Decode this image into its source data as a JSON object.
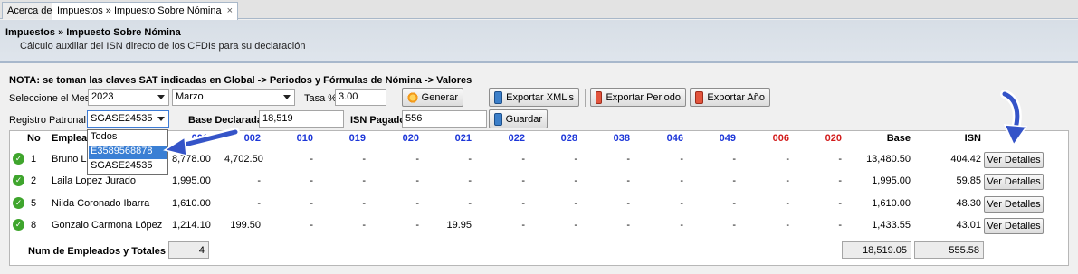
{
  "tabs": [
    {
      "label": "Acerca de"
    },
    {
      "label": "Impuestos » Impuesto Sobre Nómina",
      "close": "×"
    }
  ],
  "header": {
    "title": "Impuestos » Impuesto Sobre Nómina",
    "subtitle": "Cálculo auxiliar del ISN directo de los CFDIs para su declaración"
  },
  "note": "NOTA: se toman las claves SAT indicadas en Global -> Periodos y Fórmulas de Nómina -> Valores",
  "form": {
    "mes_label": "Seleccione el Mes",
    "year_value": "2023",
    "month_value": "Marzo",
    "tasa_label": "Tasa %",
    "tasa_value": "3.00",
    "generar_label": "Generar",
    "exportar_xml_label": "Exportar XML's",
    "exportar_periodo_label": "Exportar Periodo",
    "exportar_anio_label": "Exportar Año",
    "registro_label": "Registro Patronal",
    "registro_value": "SGASE24535",
    "base_label": "Base Declarada",
    "base_value": "18,519",
    "isn_label": "ISN Pagado",
    "isn_value": "556",
    "guardar_label": "Guardar"
  },
  "dropdown": {
    "options": [
      "Todos",
      "E3589568878",
      "SGASE24535"
    ],
    "highlighted": "E3589568878"
  },
  "table": {
    "headers": {
      "no": "No",
      "empleado": "Emplead",
      "c001": "001",
      "c002": "002",
      "c010": "010",
      "c019": "019",
      "c020": "020",
      "c021": "021",
      "c022": "022",
      "c028": "028",
      "c038": "038",
      "c046": "046",
      "c049": "049",
      "c006": "006",
      "c020b": "020",
      "base": "Base",
      "isn": "ISN"
    },
    "rows": [
      {
        "no": "1",
        "empleado": "Bruno Lo",
        "c001": "8,778.00",
        "c002": "4,702.50",
        "c010": "-",
        "c019": "-",
        "c020": "-",
        "c021": "-",
        "c022": "-",
        "c028": "-",
        "c038": "-",
        "c046": "-",
        "c049": "-",
        "c006": "-",
        "c020b": "-",
        "base": "13,480.50",
        "isn": "404.42",
        "action": "Ver Detalles"
      },
      {
        "no": "2",
        "empleado": "Laila Lopez Jurado",
        "c001": "1,995.00",
        "c002": "-",
        "c010": "-",
        "c019": "-",
        "c020": "-",
        "c021": "-",
        "c022": "-",
        "c028": "-",
        "c038": "-",
        "c046": "-",
        "c049": "-",
        "c006": "-",
        "c020b": "-",
        "base": "1,995.00",
        "isn": "59.85",
        "action": "Ver Detalles"
      },
      {
        "no": "5",
        "empleado": "Nilda Coronado Ibarra",
        "c001": "1,610.00",
        "c002": "-",
        "c010": "-",
        "c019": "-",
        "c020": "-",
        "c021": "-",
        "c022": "-",
        "c028": "-",
        "c038": "-",
        "c046": "-",
        "c049": "-",
        "c006": "-",
        "c020b": "-",
        "base": "1,610.00",
        "isn": "48.30",
        "action": "Ver Detalles"
      },
      {
        "no": "8",
        "empleado": "Gonzalo Carmona López",
        "c001": "1,214.10",
        "c002": "199.50",
        "c010": "-",
        "c019": "-",
        "c020": "-",
        "c021": "19.95",
        "c022": "-",
        "c028": "-",
        "c038": "-",
        "c046": "-",
        "c049": "-",
        "c006": "-",
        "c020b": "-",
        "base": "1,433.55",
        "isn": "43.01",
        "action": "Ver Detalles"
      }
    ]
  },
  "totals": {
    "label": "Num de Empleados y Totales",
    "count": "4",
    "base": "18,519.05",
    "isn": "555.58"
  }
}
